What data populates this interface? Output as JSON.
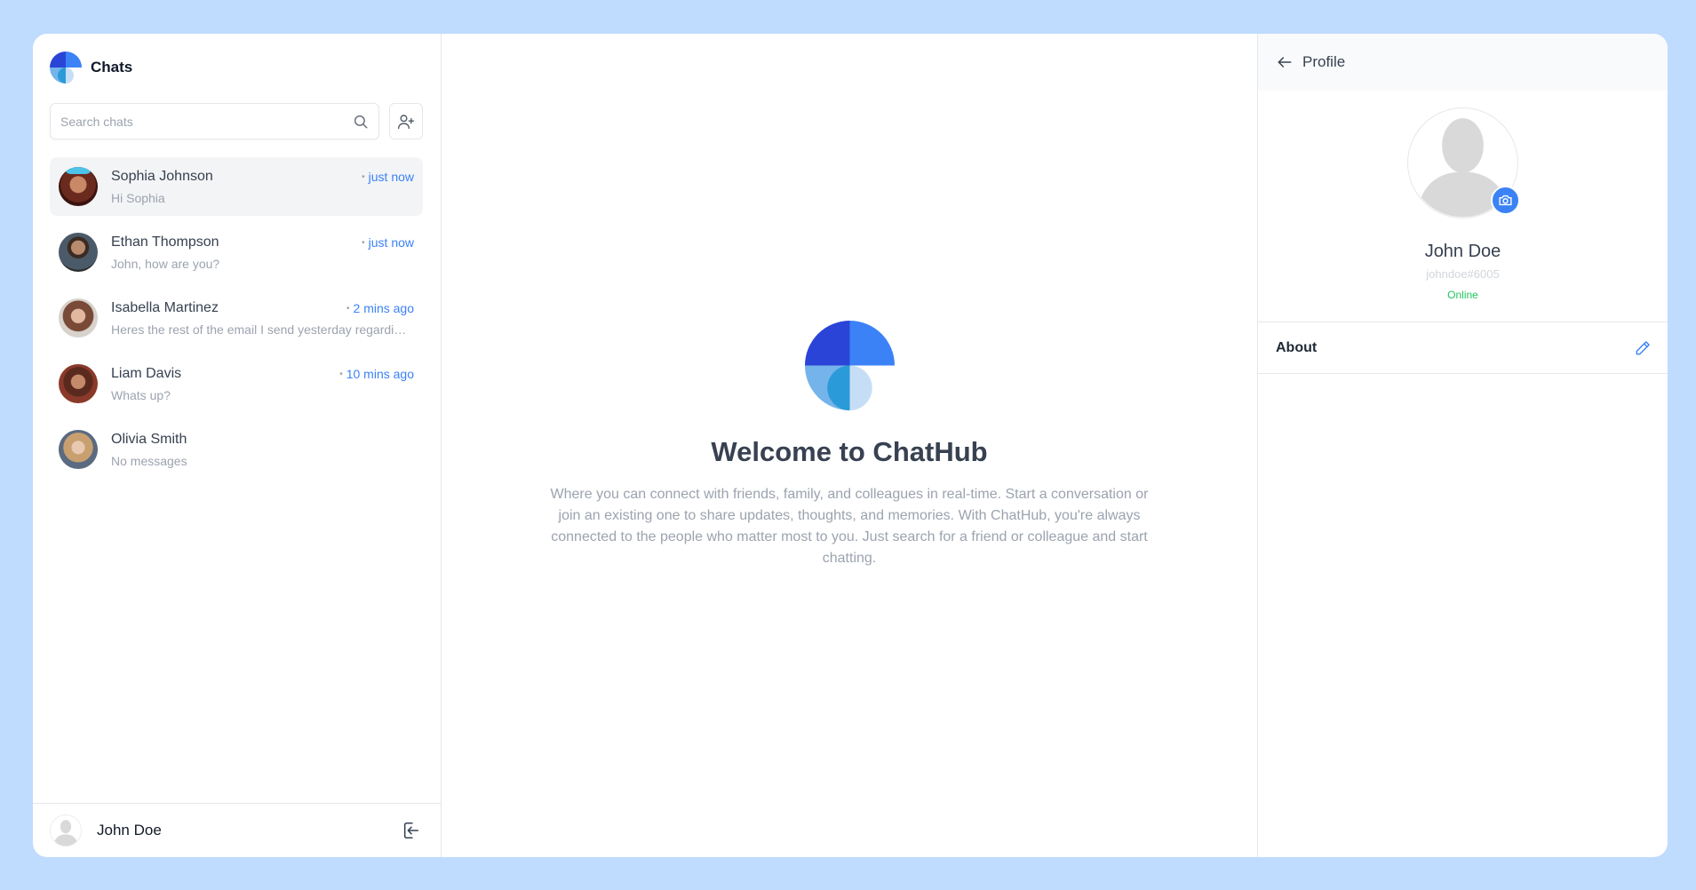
{
  "sidebar": {
    "title": "Chats",
    "search_placeholder": "Search chats",
    "chats": [
      {
        "name": "Sophia Johnson",
        "time": "just now",
        "preview": "Hi Sophia",
        "active": true
      },
      {
        "name": "Ethan Thompson",
        "time": "just now",
        "preview": "John, how are you?"
      },
      {
        "name": "Isabella Martinez",
        "time": "2 mins ago",
        "preview": "Heres the rest of the email I send yesterday regarding the project"
      },
      {
        "name": "Liam Davis",
        "time": "10 mins ago",
        "preview": "Whats up?"
      },
      {
        "name": "Olivia Smith",
        "time": "",
        "preview": "No messages"
      }
    ],
    "footer": {
      "user_name": "John Doe"
    }
  },
  "main": {
    "welcome_title": "Welcome to ChatHub",
    "welcome_text": "Where you can connect with friends, family, and colleagues in real-time. Start a conversation or join an existing one to share updates, thoughts, and memories. With ChatHub, you're always connected to the people who matter most to you. Just search for a friend or colleague and start chatting."
  },
  "profile": {
    "header_label": "Profile",
    "name": "John Doe",
    "handle": "johndoe#6005",
    "status": "Online",
    "about_label": "About"
  },
  "icons": {
    "back": "arrow-left-icon",
    "search": "search-icon",
    "add_user": "user-plus-icon",
    "logout": "logout-icon",
    "camera": "camera-icon",
    "edit": "pencil-icon"
  },
  "colors": {
    "background": "#bfdbfe",
    "accent": "#3b82f6",
    "online": "#22c55e",
    "logo_dark": "#2b44d8",
    "logo_light": "#3b82f6"
  }
}
